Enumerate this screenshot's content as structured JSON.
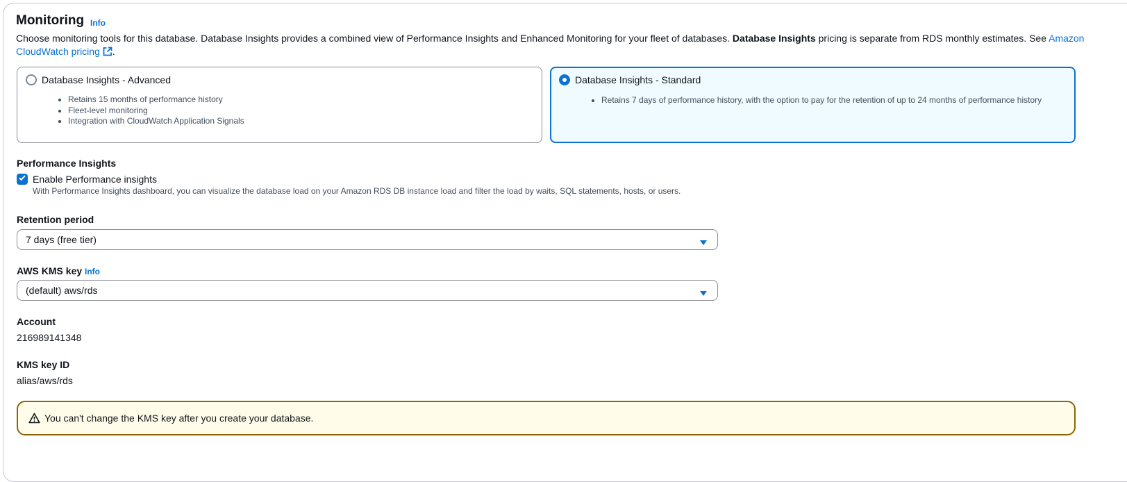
{
  "header": {
    "title": "Monitoring",
    "info": "Info",
    "description_part1": "Choose monitoring tools for this database. Database Insights provides a combined view of Performance Insights and Enhanced Monitoring for your fleet of databases. ",
    "description_bold": "Database Insights",
    "description_part2": " pricing is separate from RDS monthly estimates. See ",
    "pricing_link": "Amazon CloudWatch pricing",
    "description_end": "."
  },
  "tiles": {
    "advanced": {
      "label": "Database Insights - Advanced",
      "selected": false,
      "bullets": [
        "Retains 15 months of performance history",
        "Fleet-level monitoring",
        "Integration with CloudWatch Application Signals"
      ]
    },
    "standard": {
      "label": "Database Insights - Standard",
      "selected": true,
      "bullets": [
        "Retains 7 days of performance history, with the option to pay for the retention of up to 24 months of performance history"
      ]
    }
  },
  "performance_insights": {
    "section_label": "Performance Insights",
    "checkbox_label": "Enable Performance insights",
    "checked": true,
    "checkbox_description": "With Performance Insights dashboard, you can visualize the database load on your Amazon RDS DB instance load and filter the load by waits, SQL statements, hosts, or users."
  },
  "retention": {
    "label": "Retention period",
    "value": "7 days (free tier)"
  },
  "kms": {
    "label": "AWS KMS key",
    "info": "Info",
    "value": "(default) aws/rds"
  },
  "account": {
    "label": "Account",
    "value": "216989141348"
  },
  "kms_key_id": {
    "label": "KMS key ID",
    "value": "alias/aws/rds"
  },
  "alert": {
    "text": "You can't change the KMS key after you create your database."
  },
  "colors": {
    "accent": "#0972d3",
    "warning_border": "#8d6605",
    "warning_bg": "#fffce9",
    "selected_tile_bg": "#f0fbff"
  },
  "icons": {
    "external_link": "external-link-icon",
    "caret": "caret-down-icon",
    "warning": "warning-icon",
    "check": "check-icon"
  }
}
